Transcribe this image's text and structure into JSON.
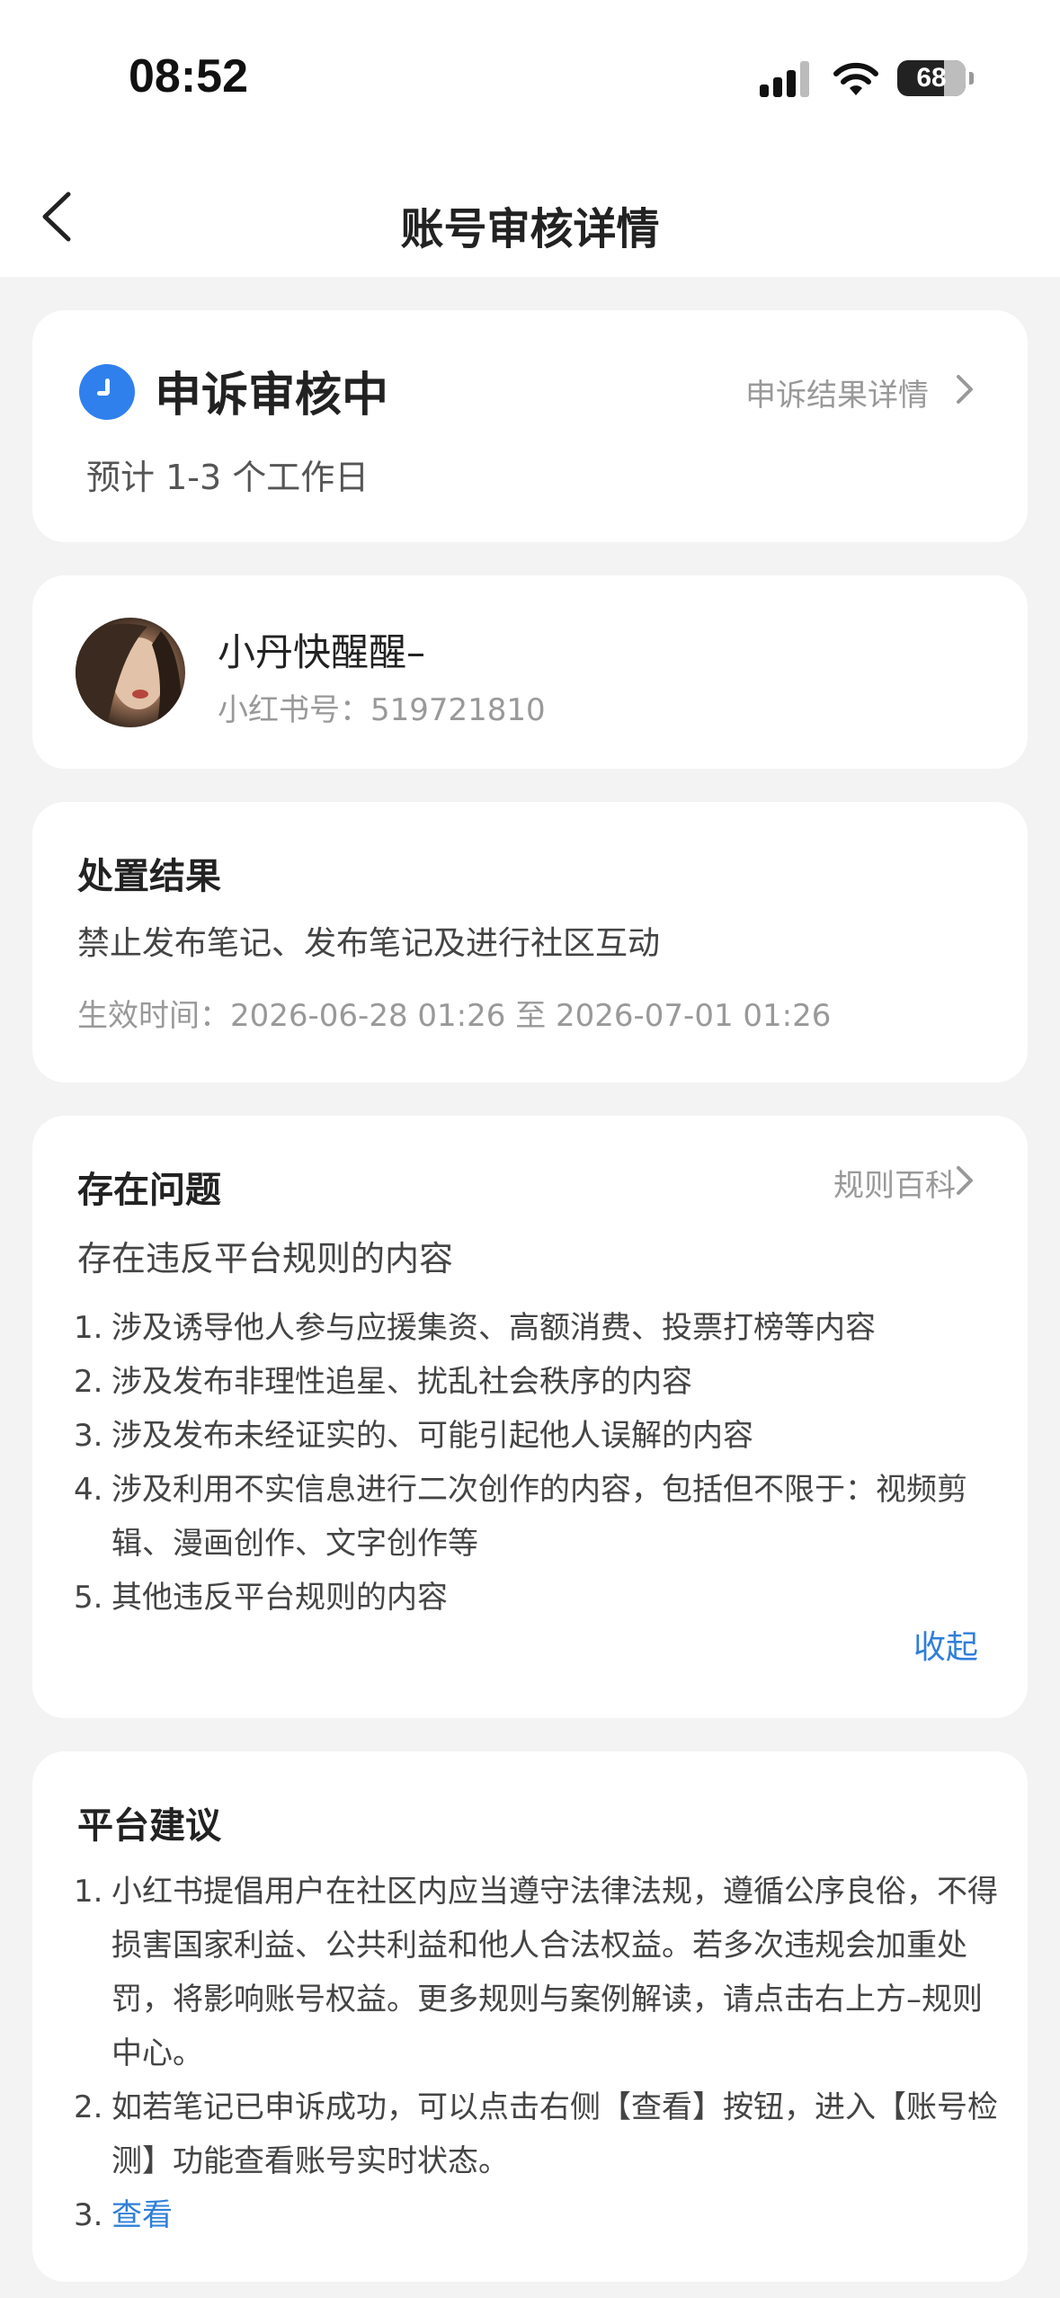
{
  "status_bar": {
    "time": "08:52",
    "battery": "68"
  },
  "nav": {
    "title": "账号审核详情"
  },
  "appeal": {
    "status": "申诉审核中",
    "result_link": "申诉结果详情",
    "estimate": "预计 1-3 个工作日"
  },
  "user": {
    "name": "小丹快醒醒–",
    "id_line": "小红书号：519721810"
  },
  "disposal": {
    "title": "处置结果",
    "result": "禁止发布笔记、发布笔记及进行社区互动",
    "effective": "生效时间：2026-06-28 01:26 至 2026-07-01 01:26"
  },
  "issues": {
    "title": "存在问题",
    "rules_link": "规则百科",
    "summary": "存在违反平台规则的内容",
    "items": [
      {
        "num": "1.",
        "text": "涉及诱导他人参与应援集资、高额消费、投票打榜等内容"
      },
      {
        "num": "2.",
        "text": "涉及发布非理性追星、扰乱社会秩序的内容"
      },
      {
        "num": "3.",
        "text": "涉及发布未经证实的、可能引起他人误解的内容"
      },
      {
        "num": "4.",
        "text": "涉及利用不实信息进行二次创作的内容，包括但不限于：视频剪辑、漫画创作、文字创作等"
      },
      {
        "num": "5.",
        "text": "其他违反平台规则的内容"
      }
    ],
    "collapse": "收起"
  },
  "advice": {
    "title": "平台建议",
    "items": [
      {
        "num": "1.",
        "text": "小红书提倡用户在社区内应当遵守法律法规，遵循公序良俗，不得损害国家利益、公共利益和他人合法权益。若多次违规会加重处罚，将影响账号权益。更多规则与案例解读，请点击右上方–规则中心。"
      },
      {
        "num": "2.",
        "text": "如若笔记已申诉成功，可以点击右侧【查看】按钮，进入【账号检测】功能查看账号实时状态。"
      },
      {
        "num": "3.",
        "text": "查看"
      }
    ]
  },
  "colors": {
    "accent": "#2f7fd9",
    "clock": "#2f80ed",
    "background": "#f3f3f3"
  }
}
